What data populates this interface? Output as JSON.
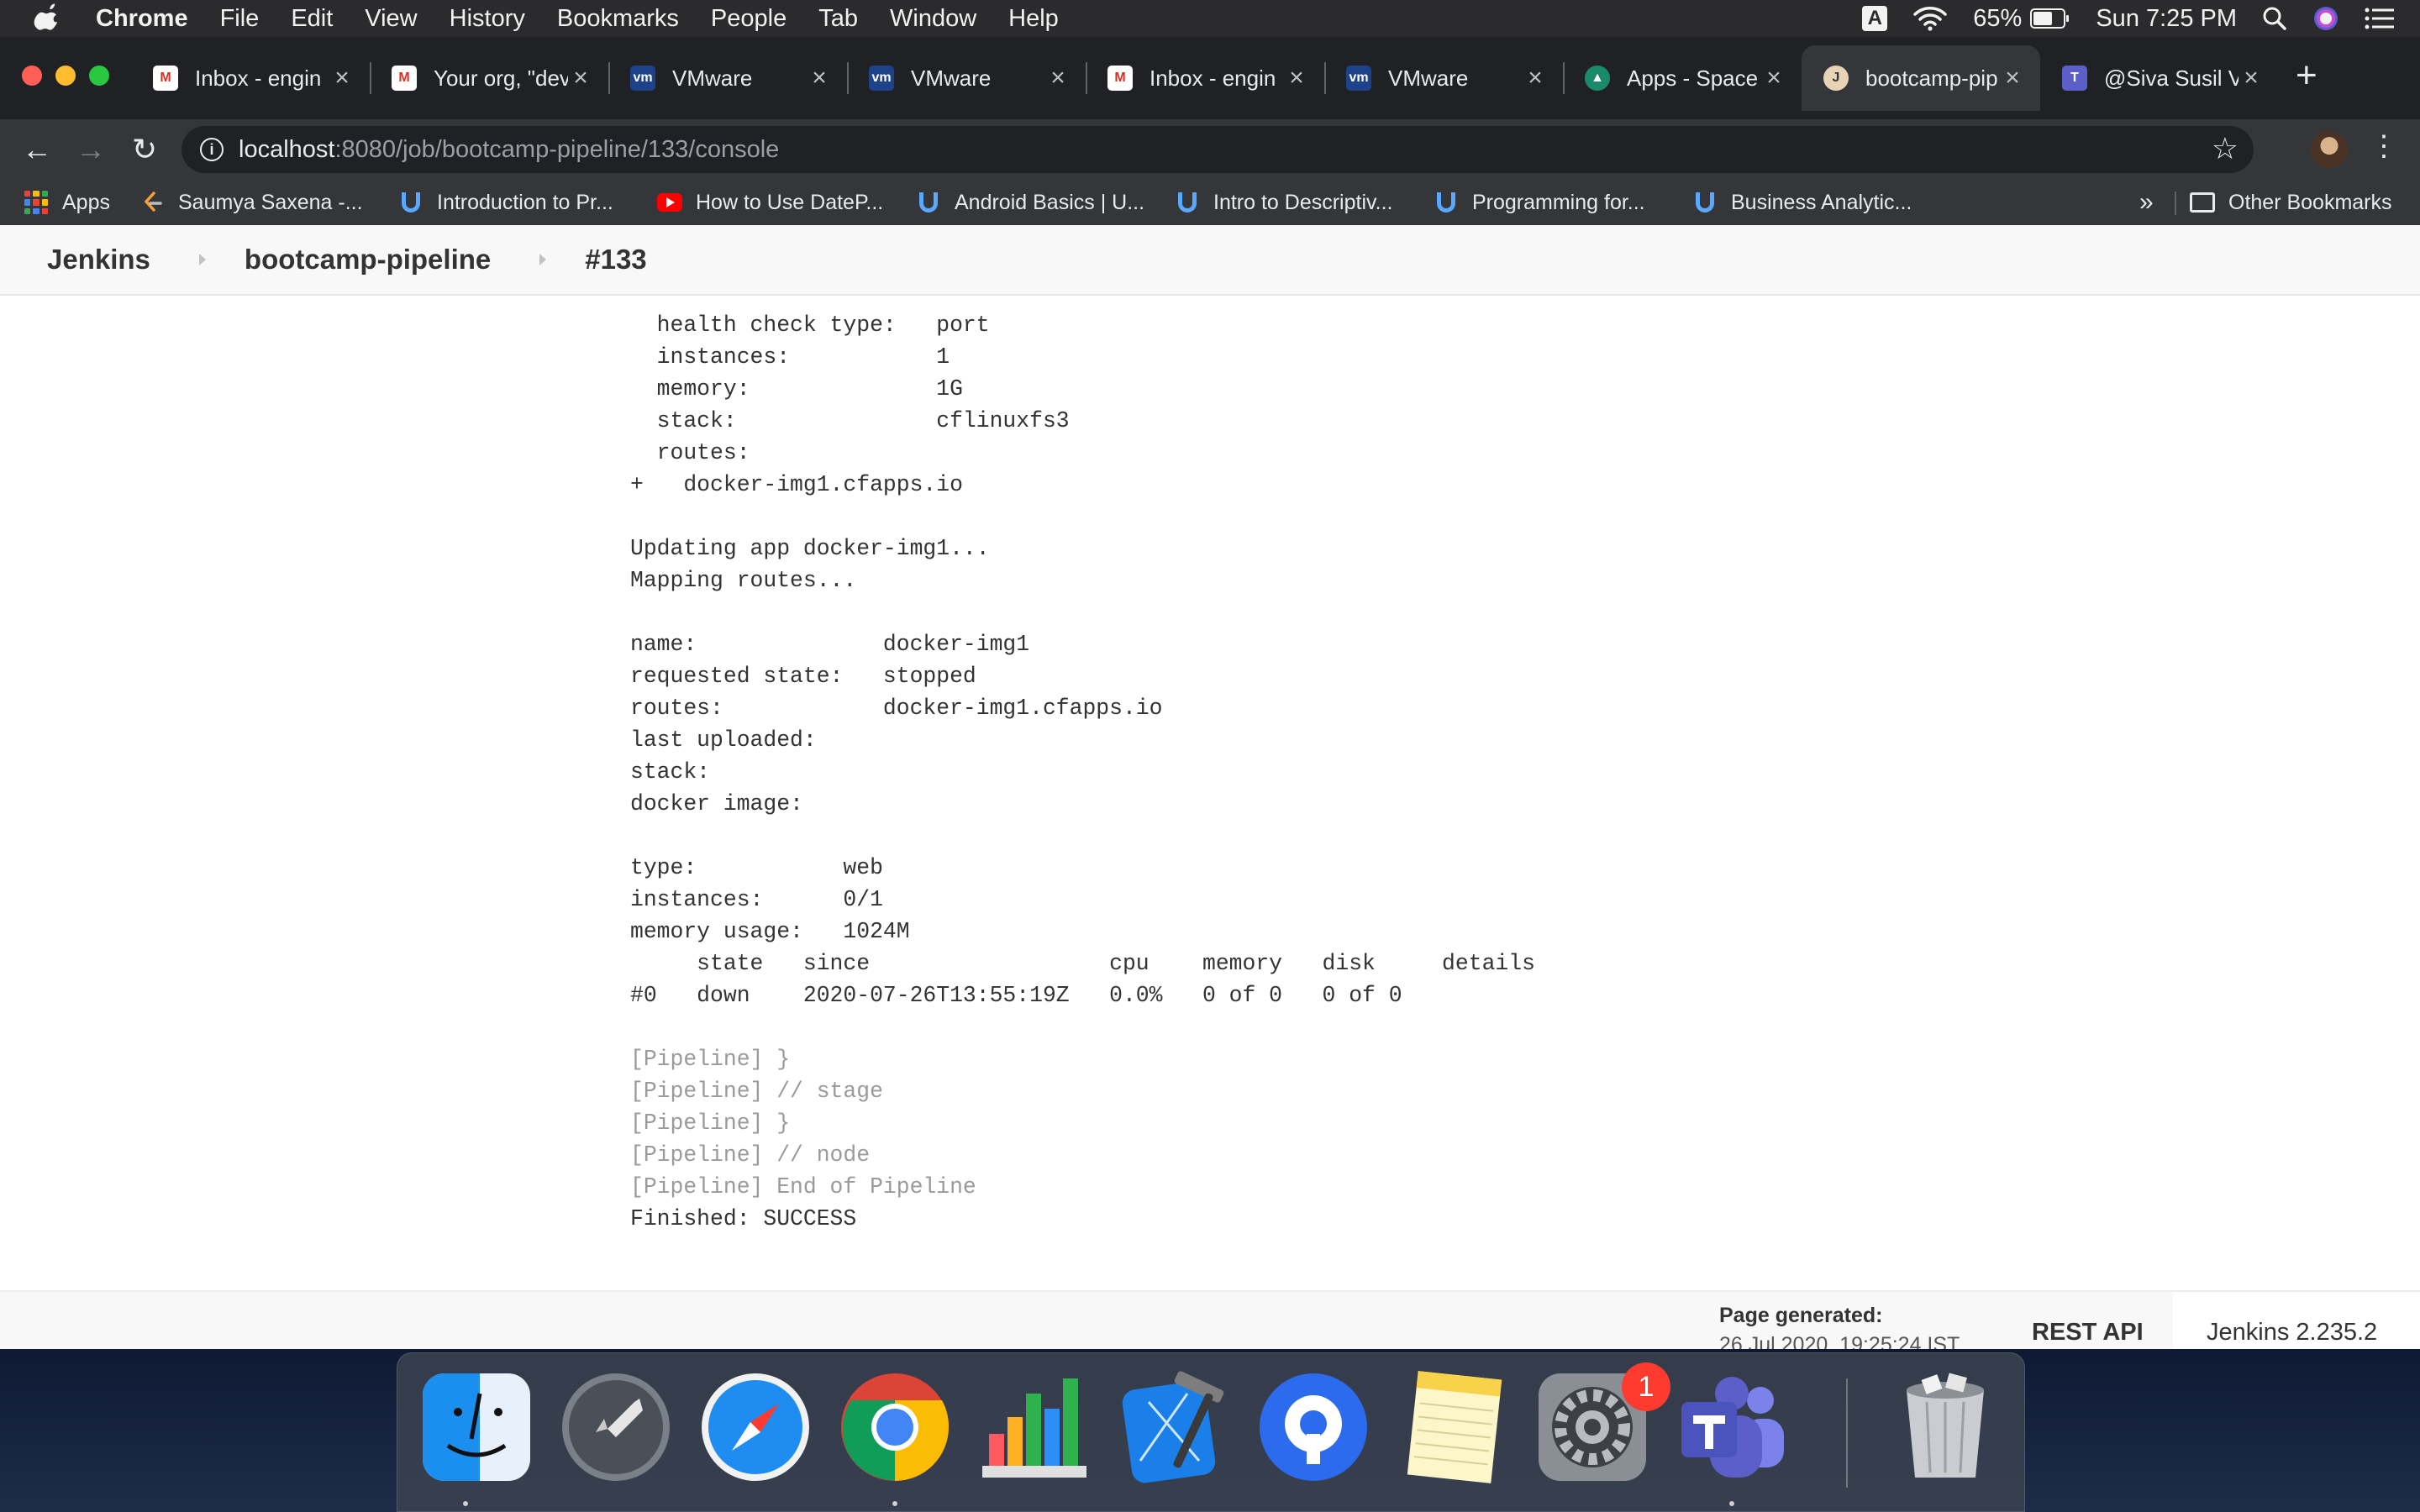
{
  "menubar": {
    "items": [
      "Chrome",
      "File",
      "Edit",
      "View",
      "History",
      "Bookmarks",
      "People",
      "Tab",
      "Window",
      "Help"
    ],
    "input_source": "A",
    "battery": "65%",
    "battery_level": 0.65,
    "clock": "Sun 7:25 PM"
  },
  "tabs": [
    {
      "title": "Inbox - engin",
      "icon": "gmail-icon"
    },
    {
      "title": "Your org, \"dev",
      "icon": "gmail-icon"
    },
    {
      "title": "VMware",
      "icon": "vmware-icon"
    },
    {
      "title": "VMware",
      "icon": "vmware-icon"
    },
    {
      "title": "Inbox - engin",
      "icon": "gmail-icon"
    },
    {
      "title": "VMware",
      "icon": "vmware-icon"
    },
    {
      "title": "Apps - Space",
      "icon": "pcf-icon"
    },
    {
      "title": "bootcamp-pip",
      "icon": "jenkins-icon",
      "active": true
    },
    {
      "title": "@Siva Susil V",
      "icon": "teams-icon"
    }
  ],
  "address": {
    "host": "localhost",
    "path": ":8080/job/bootcamp-pipeline/133/console"
  },
  "bookmarks": {
    "apps": "Apps",
    "items": [
      "Saumya Saxena -...",
      "Introduction to Pr...",
      "How to Use DateP...",
      "Android Basics | U...",
      "Intro to Descriptiv...",
      "Programming for...",
      "Business Analytic..."
    ],
    "overflow": "»",
    "other": "Other Bookmarks"
  },
  "breadcrumbs": [
    "Jenkins",
    "bootcamp-pipeline",
    "#133"
  ],
  "console_lines": [
    "  health check type:   port",
    "  instances:           1",
    "  memory:              1G",
    "  stack:               cflinuxfs3",
    "  routes:",
    "+   docker-img1.cfapps.io",
    "",
    "Updating app docker-img1...",
    "Mapping routes...",
    "",
    "name:              docker-img1",
    "requested state:   stopped",
    "routes:            docker-img1.cfapps.io",
    "last uploaded:",
    "stack:",
    "docker image:",
    "",
    "type:           web",
    "instances:      0/1",
    "memory usage:   1024M",
    "     state   since                  cpu    memory   disk     details",
    "#0   down    2020-07-26T13:55:19Z   0.0%   0 of 0   0 of 0",
    "",
    "[Pipeline] }",
    "[Pipeline] // stage",
    "[Pipeline] }",
    "[Pipeline] // node",
    "[Pipeline] End of Pipeline",
    "Finished: SUCCESS"
  ],
  "footer": {
    "generated_label": "Page generated:",
    "generated_value": "26 Jul 2020, 19:25:24 IST",
    "rest_api": "REST API",
    "version": "Jenkins 2.235.2"
  },
  "dock": {
    "apps": [
      "finder-icon",
      "launchpad-icon",
      "safari-icon",
      "chrome-icon",
      "numbers-icon",
      "xcode-icon",
      "signal-icon",
      "notes-icon",
      "system-preferences-icon",
      "teams-icon",
      "trash-icon"
    ],
    "badge": "1"
  }
}
